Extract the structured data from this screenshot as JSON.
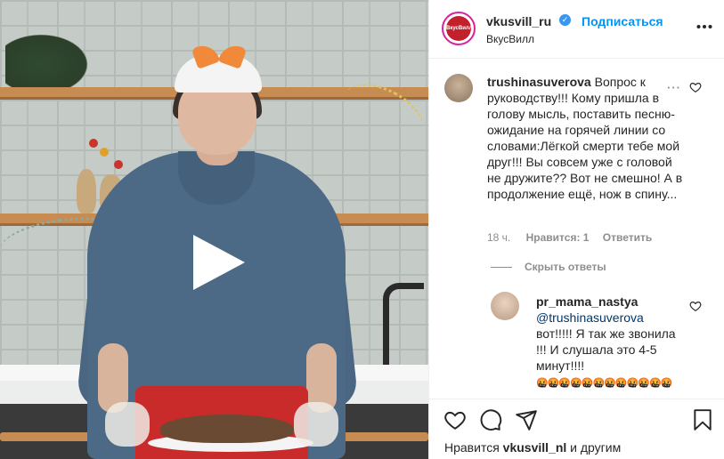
{
  "post": {
    "username": "vkusvill_ru",
    "follow_label": "Подписаться",
    "location": "ВкусВилл",
    "logo_text": "ВкусВилл"
  },
  "comments": [
    {
      "username": "trushinasuverova",
      "text": "Вопрос к руководству!!! Кому пришла в голову мысль, поставить песню-ожидание на горячей линии со словами:Лёгкой смерти тебе мой друг!!! Вы совсем уже с головой не дружите?? Вот не смешно! А в продолжение ещё, нож в спину...",
      "time": "18 ч.",
      "likes": "Нравится: 1",
      "reply_label": "Ответить"
    }
  ],
  "hide_replies_label": "Скрыть ответы",
  "reply": {
    "username": "pr_mama_nastya",
    "mention": "@trushinasuverova",
    "text": "вот!!!!! Я так же звонила !!! И слушала это 4-5 минут!!!!",
    "emoji": "🤬🤬🤬🤬🤬🤬🤬🤬🤬🤬🤬🤬"
  },
  "likes_line": {
    "prefix": "Нравится",
    "user": "vkusvill_nl",
    "suffix": "и другим"
  },
  "colors": {
    "link_blue": "#0095f6",
    "verified_blue": "#3897f0",
    "muted": "#8e8e8e"
  },
  "icons": [
    "play-icon",
    "more-icon",
    "heart-icon",
    "comment-icon",
    "share-icon",
    "bookmark-icon",
    "verified-badge-icon"
  ]
}
